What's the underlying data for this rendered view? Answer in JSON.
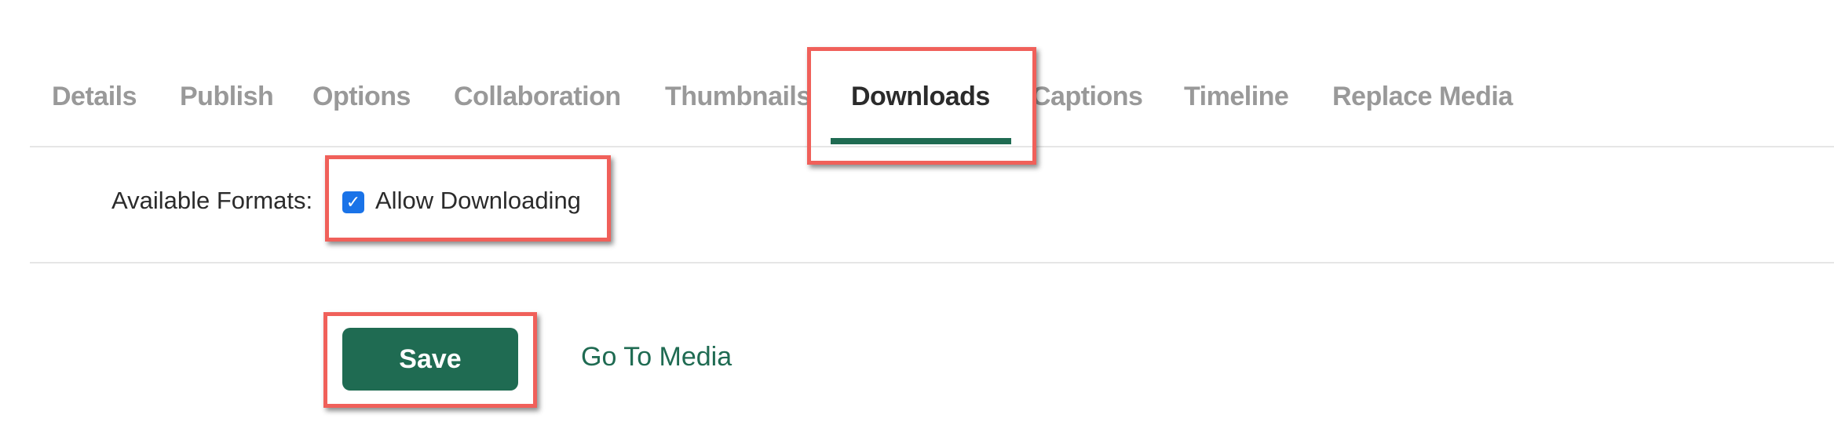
{
  "tabs": [
    {
      "label": "Details",
      "active": false
    },
    {
      "label": "Publish",
      "active": false
    },
    {
      "label": "Options",
      "active": false
    },
    {
      "label": "Collaboration",
      "active": false
    },
    {
      "label": "Thumbnails",
      "active": false
    },
    {
      "label": "Downloads",
      "active": true
    },
    {
      "label": "Captions",
      "active": false
    },
    {
      "label": "Timeline",
      "active": false
    },
    {
      "label": "Replace Media",
      "active": false
    }
  ],
  "downloads": {
    "formats_label": "Available Formats:",
    "allow_downloading_label": "Allow Downloading",
    "allow_downloading_checked": true
  },
  "actions": {
    "save_label": "Save",
    "go_to_media_label": "Go To Media"
  },
  "colors": {
    "accent": "#1f6b52",
    "checkbox": "#1a73e8",
    "highlight": "#f0605a"
  }
}
